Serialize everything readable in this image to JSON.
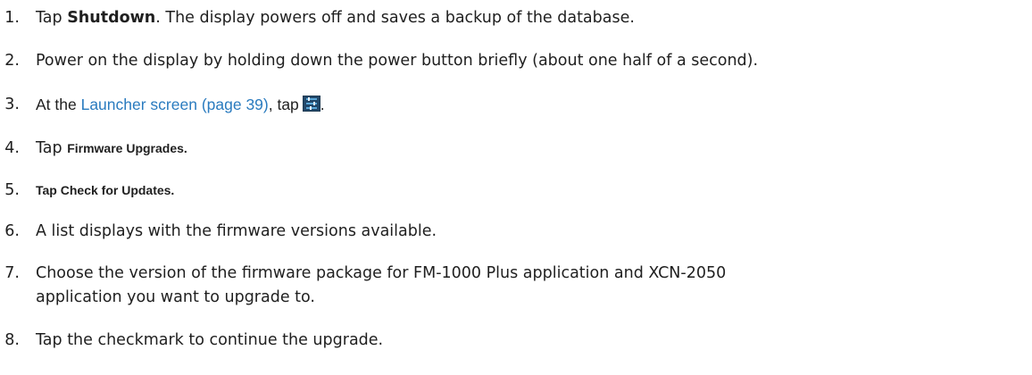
{
  "steps": [
    {
      "num": "1.",
      "pre": "Tap ",
      "bold": "Shutdown",
      "post": ". The display powers off and saves a backup of the database."
    },
    {
      "num": "2.",
      "text": "Power on the display by holding down the power button briefly (about one half of a second)."
    },
    {
      "num": "3.",
      "pre": "At the ",
      "link": "Launcher screen (page 39)",
      "post": ", tap",
      "end": "."
    },
    {
      "num": "4.",
      "pre": "Tap ",
      "bold": "Firmware Upgrades."
    },
    {
      "num": "5.",
      "bold": "Tap Check for Updates."
    },
    {
      "num": "6.",
      "text": "A list displays with the firmware versions available."
    },
    {
      "num": "7.",
      "text": "Choose the version of the firmware package for FM-1000 Plus application and XCN-2050",
      "text2": "application you want to upgrade to."
    },
    {
      "num": "8.",
      "text": "Tap the checkmark to continue the upgrade."
    }
  ],
  "icons": {
    "settings": "settings-icon"
  },
  "colors": {
    "text": "#1f1f1f",
    "link": "#2a7bbf",
    "icon_bg": "#1d3a52",
    "icon_fg": "#5aa7d8"
  }
}
